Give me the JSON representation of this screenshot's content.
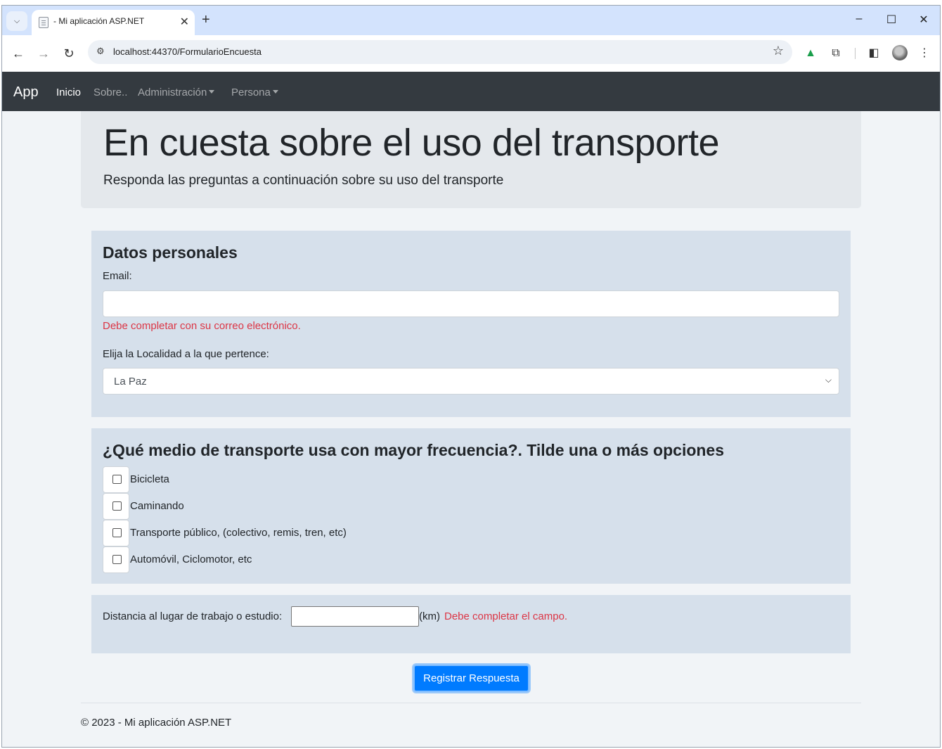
{
  "browser": {
    "tab_title": "- Mi aplicación ASP.NET",
    "url": "localhost:44370/FormularioEncuesta"
  },
  "navbar": {
    "brand": "App",
    "links": [
      "Inicio",
      "Sobre..",
      "Administración",
      "Persona"
    ]
  },
  "jumbotron": {
    "title": "En cuesta sobre el uso del transporte",
    "lead": "Responda las preguntas a continuación sobre su uso del transporte"
  },
  "personal": {
    "heading": "Datos personales",
    "email_label": "Email:",
    "email_value": "",
    "email_error": "Debe completar con su correo electrónico.",
    "locality_label": "Elija la Localidad a la que pertence:",
    "locality_selected": "La Paz"
  },
  "transport": {
    "heading": "¿Qué medio de transporte usa con mayor frecuencia?. Tilde una o más opciones",
    "options": [
      {
        "label": "Bicicleta",
        "checked": false
      },
      {
        "label": "Caminando",
        "checked": false
      },
      {
        "label": "Transporte público, (colectivo, remis, tren, etc)",
        "checked": false
      },
      {
        "label": "Automóvil, Ciclomotor, etc",
        "checked": false
      }
    ]
  },
  "distance": {
    "label": "Distancia al lugar de trabajo o estudio:",
    "value": "",
    "unit": "(km)",
    "error": "Debe completar el campo."
  },
  "submit_label": "Registrar Respuesta",
  "footer": "© 2023 - Mi aplicación ASP.NET"
}
